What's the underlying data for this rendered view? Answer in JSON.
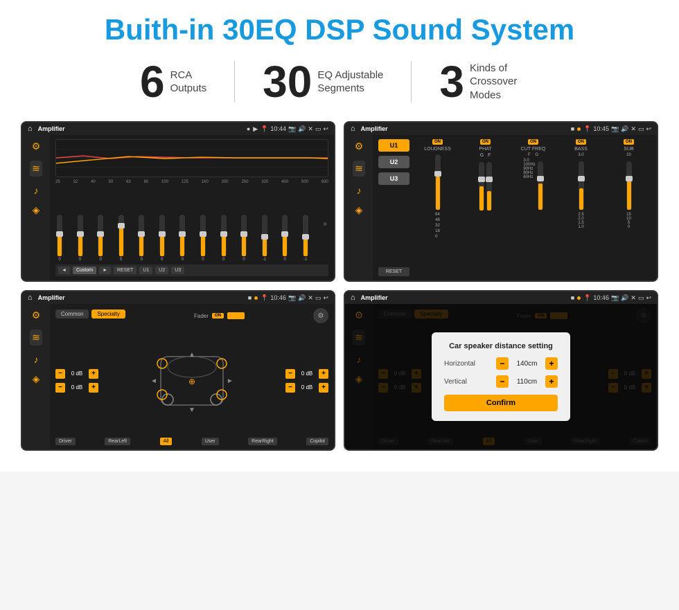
{
  "page": {
    "title": "Buith-in 30EQ DSP Sound System",
    "title_color": "#1a9ade"
  },
  "stats": [
    {
      "number": "6",
      "label_line1": "RCA",
      "label_line2": "Outputs"
    },
    {
      "number": "30",
      "label_line1": "EQ Adjustable",
      "label_line2": "Segments"
    },
    {
      "number": "3",
      "label_line1": "Kinds of",
      "label_line2": "Crossover Modes"
    }
  ],
  "screens": {
    "eq_screen": {
      "app_name": "Amplifier",
      "time": "10:44",
      "eq_freqs": [
        "25",
        "32",
        "40",
        "50",
        "63",
        "80",
        "100",
        "125",
        "160",
        "200",
        "250",
        "320",
        "400",
        "500",
        "630"
      ],
      "eq_vals": [
        "0",
        "0",
        "0",
        "5",
        "0",
        "0",
        "0",
        "0",
        "0",
        "0",
        "-1",
        "0",
        "-1"
      ],
      "bottom_controls": [
        "◄",
        "Custom",
        "►",
        "RESET",
        "U1",
        "U2",
        "U3"
      ]
    },
    "crossover_screen": {
      "app_name": "Amplifier",
      "time": "10:45",
      "u_buttons": [
        "U1",
        "U2",
        "U3"
      ],
      "reset_label": "RESET",
      "panels": [
        {
          "id": "LOUDNESS",
          "on": true
        },
        {
          "id": "PHAT",
          "on": true
        },
        {
          "id": "CUT FREQ",
          "on": true
        },
        {
          "id": "BASS",
          "on": true
        },
        {
          "id": "SUB",
          "on": true
        }
      ]
    },
    "speaker_screen": {
      "app_name": "Amplifier",
      "time": "10:46",
      "tabs": [
        "Common",
        "Specialty"
      ],
      "active_tab": "Specialty",
      "fader_label": "Fader",
      "on_label": "ON",
      "db_controls": [
        "0 dB",
        "0 dB",
        "0 dB",
        "0 dB"
      ],
      "bottom_labels": [
        "Driver",
        "RearLeft",
        "All",
        "User",
        "RearRight",
        "Copilot"
      ]
    },
    "dialog_screen": {
      "app_name": "Amplifier",
      "time": "10:46",
      "tabs": [
        "Common",
        "Specialty"
      ],
      "dialog": {
        "title": "Car speaker distance setting",
        "fields": [
          {
            "label": "Horizontal",
            "value": "140cm"
          },
          {
            "label": "Vertical",
            "value": "110cm"
          }
        ],
        "confirm_label": "Confirm"
      }
    }
  }
}
